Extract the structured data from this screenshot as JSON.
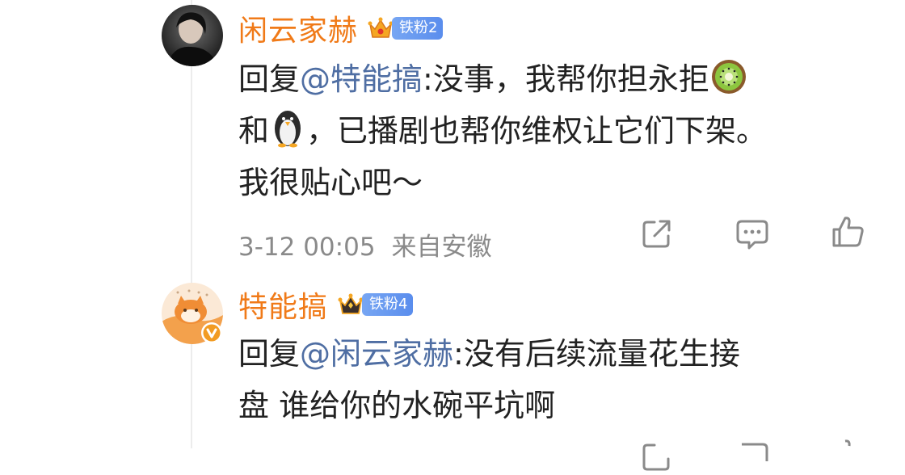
{
  "comments": [
    {
      "username": "闲云家赫",
      "fan_badge": "铁粉2",
      "reply_prefix": "回复",
      "mention": "@特能搞",
      "colon": ":",
      "line1": "没事，我帮你担永拒",
      "line2a": "和",
      "line2b": "，已播剧也帮你维权让它们下架。",
      "line3": "我很贴心吧～",
      "emoji1": "kiwi-emoji",
      "emoji2": "penguin-emoji",
      "time": "3-12 00:05",
      "source": "来自安徽"
    },
    {
      "username": "特能搞",
      "fan_badge": "铁粉4",
      "reply_prefix": "回复",
      "mention": "@闲云家赫",
      "colon": ":",
      "line1": "没有后续流量花生接",
      "line2": "盘 谁给你的水碗平坑啊"
    }
  ],
  "colors": {
    "username": "#f07a18",
    "mention": "#4f6ea3",
    "badge": "#5a8ded",
    "meta": "#8a8a8a"
  },
  "icons": [
    "share-icon",
    "comment-icon",
    "like-icon",
    "verified-badge-icon",
    "crown-icon"
  ]
}
